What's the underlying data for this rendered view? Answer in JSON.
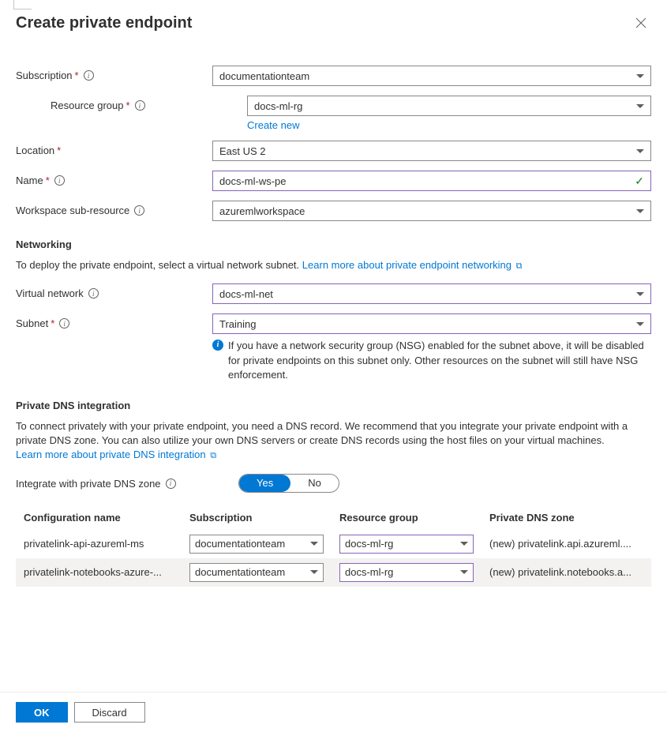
{
  "header": {
    "title": "Create private endpoint"
  },
  "fields": {
    "subscription": {
      "label": "Subscription",
      "value": "documentationteam"
    },
    "resource_group": {
      "label": "Resource group",
      "value": "docs-ml-rg",
      "create_new": "Create new"
    },
    "location": {
      "label": "Location",
      "value": "East US 2"
    },
    "name": {
      "label": "Name",
      "value": "docs-ml-ws-pe"
    },
    "subresource": {
      "label": "Workspace sub-resource",
      "value": "azuremlworkspace"
    },
    "virtual_network": {
      "label": "Virtual network",
      "value": "docs-ml-net"
    },
    "subnet": {
      "label": "Subnet",
      "value": "Training"
    },
    "integrate_dns": {
      "label": "Integrate with private DNS zone",
      "yes": "Yes",
      "no": "No"
    }
  },
  "networking": {
    "heading": "Networking",
    "help": "To deploy the private endpoint, select a virtual network subnet.",
    "learn_more": "Learn more about private endpoint networking",
    "nsg_note": "If you have a network security group (NSG) enabled for the subnet above, it will be disabled for private endpoints on this subnet only. Other resources on the subnet will still have NSG enforcement."
  },
  "dns": {
    "heading": "Private DNS integration",
    "help": "To connect privately with your private endpoint, you need a DNS record. We recommend that you integrate your private endpoint with a private DNS zone. You can also utilize your own DNS servers or create DNS records using the host files on your virtual machines.",
    "learn_more": "Learn more about private DNS integration"
  },
  "table": {
    "headers": {
      "config": "Configuration name",
      "subscription": "Subscription",
      "rg": "Resource group",
      "zone": "Private DNS zone"
    },
    "rows": [
      {
        "config": "privatelink-api-azureml-ms",
        "subscription": "documentationteam",
        "rg": "docs-ml-rg",
        "zone": "(new) privatelink.api.azureml...."
      },
      {
        "config": "privatelink-notebooks-azure-...",
        "subscription": "documentationteam",
        "rg": "docs-ml-rg",
        "zone": "(new) privatelink.notebooks.a..."
      }
    ]
  },
  "footer": {
    "ok": "OK",
    "discard": "Discard"
  }
}
